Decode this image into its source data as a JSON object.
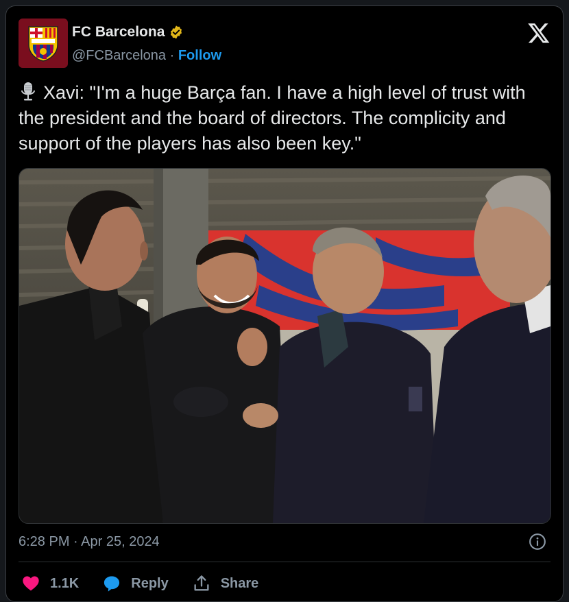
{
  "account": {
    "name": "FC Barcelona",
    "handle": "@FCBarcelona",
    "separator": "·",
    "follow_label": "Follow"
  },
  "tweet": {
    "text": "Xavi: \"I'm a huge Barça fan. I have a high level of trust with the president and the board of directors. The complicity and support of the players has also been key.\"",
    "timestamp": "6:28 PM · Apr 25, 2024"
  },
  "actions": {
    "like_count": "1.1K",
    "reply_label": "Reply",
    "share_label": "Share"
  },
  "colors": {
    "accent": "#1d9bf0",
    "like": "#f91880",
    "verified": "#e2b719",
    "brand": "#a50044"
  }
}
